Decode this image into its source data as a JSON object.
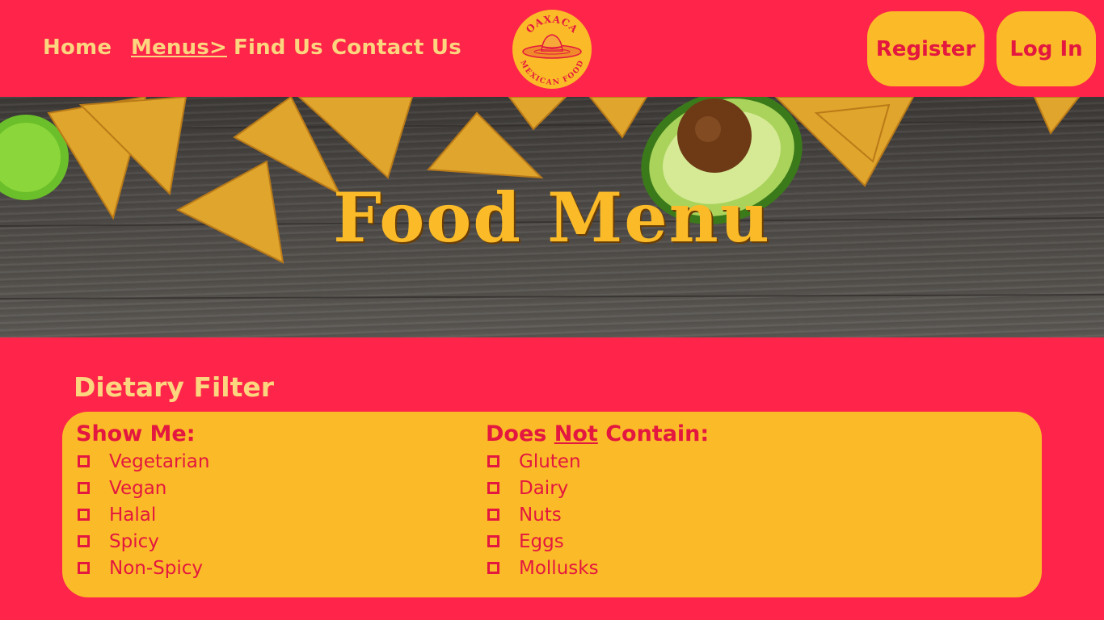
{
  "nav": {
    "items": [
      {
        "label": "Home",
        "active": false
      },
      {
        "label": "Menus>",
        "active": true
      },
      {
        "label": "Find Us",
        "active": false
      },
      {
        "label": "Contact Us",
        "active": false
      }
    ]
  },
  "logo": {
    "top_text": "OAXACA",
    "bottom_text": "MEXICAN FOOD"
  },
  "auth": {
    "register_label": "Register",
    "login_label": "Log In"
  },
  "hero": {
    "title": "Food Menu"
  },
  "filter": {
    "title": "Dietary Filter",
    "show_me": {
      "heading": "Show Me:",
      "options": [
        "Vegetarian",
        "Vegan",
        "Halal",
        "Spicy",
        "Non-Spicy"
      ]
    },
    "does_not_contain": {
      "heading_pre": "Does ",
      "heading_not": "Not",
      "heading_post": " Contain:",
      "options": [
        "Gluten",
        "Dairy",
        "Nuts",
        "Eggs",
        "Mollusks"
      ]
    }
  },
  "colors": {
    "primary": "#ff2449",
    "accent": "#fbbb28",
    "text_light": "#fcd57f",
    "text_dark": "#e3173f"
  }
}
